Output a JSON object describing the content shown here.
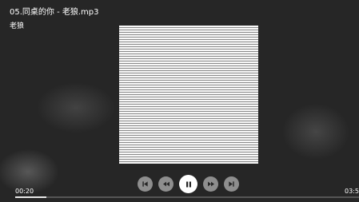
{
  "track": {
    "title": "05.同桌的你 - 老狼.mp3",
    "artist": "老狼"
  },
  "playback": {
    "current_time": "00:20",
    "total_time": "03:5",
    "progress": 0.09
  },
  "controls": [
    {
      "name": "skip-previous",
      "icon": "skip-previous-icon"
    },
    {
      "name": "rewind",
      "icon": "rewind-icon"
    },
    {
      "name": "pause",
      "icon": "pause-icon"
    },
    {
      "name": "fast-forward",
      "icon": "fast-forward-icon"
    },
    {
      "name": "skip-next",
      "icon": "skip-next-icon"
    }
  ],
  "colors": {
    "background": "#262626",
    "control": "#8e8e8e",
    "control_active": "#ffffff",
    "icon": "#262626"
  }
}
